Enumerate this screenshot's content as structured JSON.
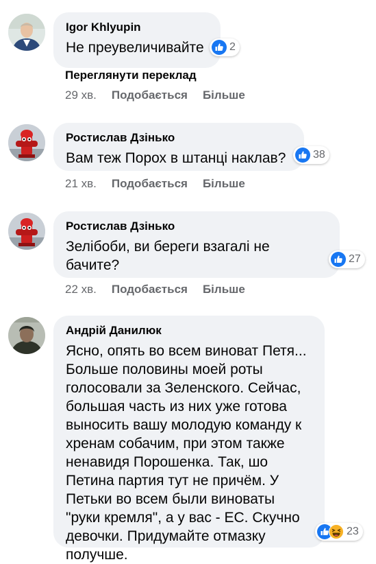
{
  "comments": [
    {
      "author": "Igor Khlyupin",
      "text": "Не преувеличивайте",
      "reactions": "2",
      "translate_link": "Переглянути переклад",
      "time": "29 хв.",
      "like": "Подобається",
      "more": "Більше"
    },
    {
      "author": "Ростислав Дзінько",
      "text": "Вам теж Порох в штанці наклав?",
      "reactions": "38",
      "time": "21 хв.",
      "like": "Подобається",
      "more": "Більше"
    },
    {
      "author": "Ростислав Дзінько",
      "text": "Зелібоби, ви береги взагалі не бачите?",
      "reactions": "27",
      "time": "22 хв.",
      "like": "Подобається",
      "more": "Більше"
    },
    {
      "author": "Андрій Данилюк",
      "text": "Ясно, опять во всем виноват Петя... Больше половины моей роты голосовали за Зеленского. Сейчас, большая часть из них уже готова выносить вашу молодую команду к хренам собачим, при этом также ненавидя Порошенка. Так, шо Петина партия тут не причём. У Петьки во всем были виноваты \"руки кремля\", а у вас - ЕС. Скучно девочки. Придумайте отмазку получше.",
      "reactions": "23"
    }
  ],
  "colors": {
    "like_blue": "#1877f2",
    "haha_yellow": "#f7b125",
    "bubble_bg": "#f0f2f5",
    "meta_gray": "#65676b"
  },
  "icons": {
    "like": "thumbs-up-icon",
    "haha": "laughing-face-icon"
  }
}
